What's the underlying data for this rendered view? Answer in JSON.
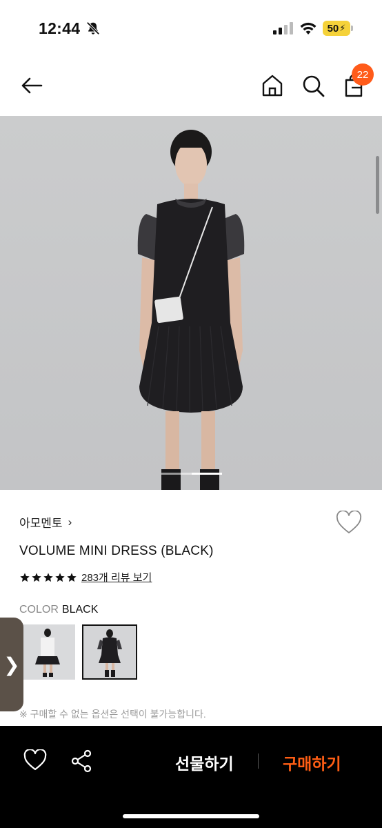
{
  "status_bar": {
    "time": "12:44",
    "battery": "50"
  },
  "nav": {
    "cart_count": "22"
  },
  "product": {
    "brand": "아모멘토",
    "brand_chevron": "›",
    "name": "VOLUME MINI DRESS (BLACK)",
    "rating_stars": 5,
    "review_link": "283개 리뷰 보기",
    "color_label": "COLOR",
    "color_value": "BLACK",
    "option_note": "※ 구매할 수 없는 옵션은 선택이 불가능합니다."
  },
  "gallery": {
    "page_index": 2,
    "page_count": 2
  },
  "side_tab": {
    "label": "❯"
  },
  "bottom_bar": {
    "gift_label": "선물하기",
    "buy_label": "구매하기",
    "accent_color": "#ff5e14"
  },
  "icons": [
    "back-arrow-icon",
    "home-icon",
    "search-icon",
    "shopping-bag-icon",
    "heart-icon",
    "share-icon",
    "star-icon",
    "bell-slash-icon",
    "signal-icon",
    "wifi-icon"
  ]
}
